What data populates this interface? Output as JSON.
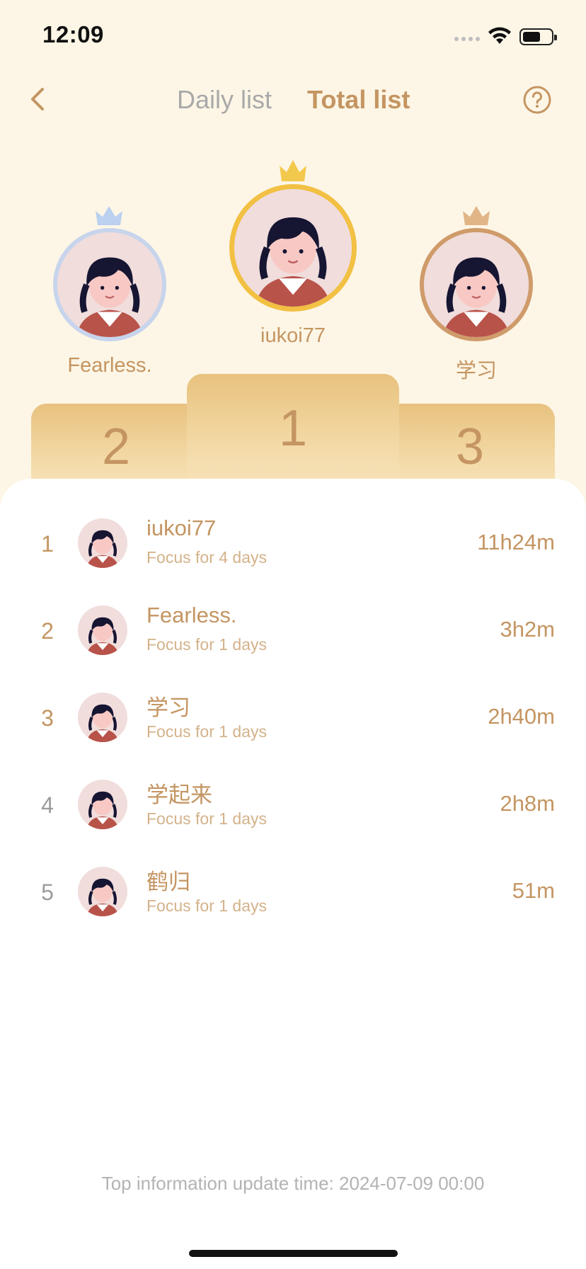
{
  "status_bar": {
    "time": "12:09"
  },
  "nav": {
    "tabs": [
      {
        "label": "Daily list",
        "active": false
      },
      {
        "label": "Total list",
        "active": true
      }
    ]
  },
  "podium": {
    "first": {
      "name": "iukoi77",
      "rank": "1",
      "crown_color": "#f2c84a",
      "ring_color": "#f2c043"
    },
    "second": {
      "name": "Fearless.",
      "rank": "2",
      "crown_color": "#b8cdf0",
      "ring_color": "#c7d4ec"
    },
    "third": {
      "name": "学习",
      "rank": "3",
      "crown_color": "#e2b587",
      "ring_color": "#cf9b6a"
    }
  },
  "ranking": [
    {
      "rank": "1",
      "name": "iukoi77",
      "subtitle": "Focus for 4 days",
      "time": "11h24m"
    },
    {
      "rank": "2",
      "name": "Fearless.",
      "subtitle": "Focus for 1 days",
      "time": "3h2m"
    },
    {
      "rank": "3",
      "name": "学习",
      "subtitle": "Focus for 1 days",
      "time": "2h40m"
    },
    {
      "rank": "4",
      "name": "学起来",
      "subtitle": "Focus for 1 days",
      "time": "2h8m"
    },
    {
      "rank": "5",
      "name": "鹤归",
      "subtitle": "Focus for 1 days",
      "time": "51m"
    }
  ],
  "footer": {
    "update_text": "Top information update time: 2024-07-09 00:00"
  },
  "colors": {
    "accent": "#c49562",
    "background": "#fdf6e6",
    "card": "#ffffff",
    "muted": "#a9a9a9"
  }
}
